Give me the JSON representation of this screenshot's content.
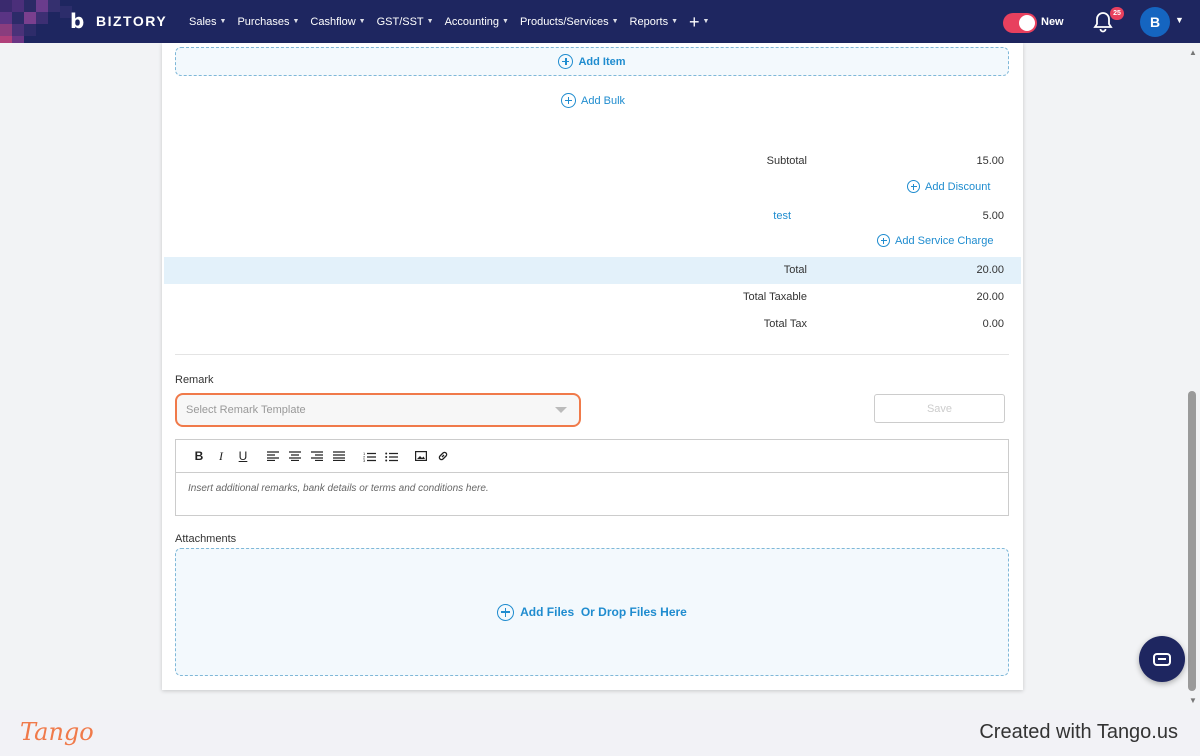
{
  "app": {
    "brand": "BIZTORY",
    "nav": [
      {
        "label": "Sales"
      },
      {
        "label": "Purchases"
      },
      {
        "label": "Cashflow"
      },
      {
        "label": "GST/SST"
      },
      {
        "label": "Accounting"
      },
      {
        "label": "Products/Services"
      },
      {
        "label": "Reports"
      }
    ],
    "toggle_label": "New",
    "notification_count": "25",
    "avatar_initial": "B"
  },
  "items": {
    "add_item_label": "Add Item",
    "add_bulk_label": "Add Bulk"
  },
  "summary": {
    "subtotal_label": "Subtotal",
    "subtotal_value": "15.00",
    "add_discount_label": "Add Discount",
    "charge_label": "test",
    "charge_value": "5.00",
    "add_service_charge_label": "Add Service Charge",
    "total_label": "Total",
    "total_value": "20.00",
    "total_taxable_label": "Total Taxable",
    "total_taxable_value": "20.00",
    "total_tax_label": "Total Tax",
    "total_tax_value": "0.00"
  },
  "remark": {
    "label": "Remark",
    "template_placeholder": "Select Remark Template",
    "save_label": "Save",
    "editor_placeholder": "Insert additional remarks, bank details or terms and conditions here.",
    "toolbar": [
      "B",
      "I",
      "U"
    ]
  },
  "attachments": {
    "label": "Attachments",
    "dropzone_label": "Add Files  Or Drop Files Here"
  },
  "footer": {
    "logo": "Tango",
    "created_text": "Created with Tango.us"
  },
  "colors": {
    "nav_bg": "#1e2660",
    "accent": "#1f8ccf",
    "highlight": "#f07a4a",
    "toggle": "#e8405e"
  }
}
